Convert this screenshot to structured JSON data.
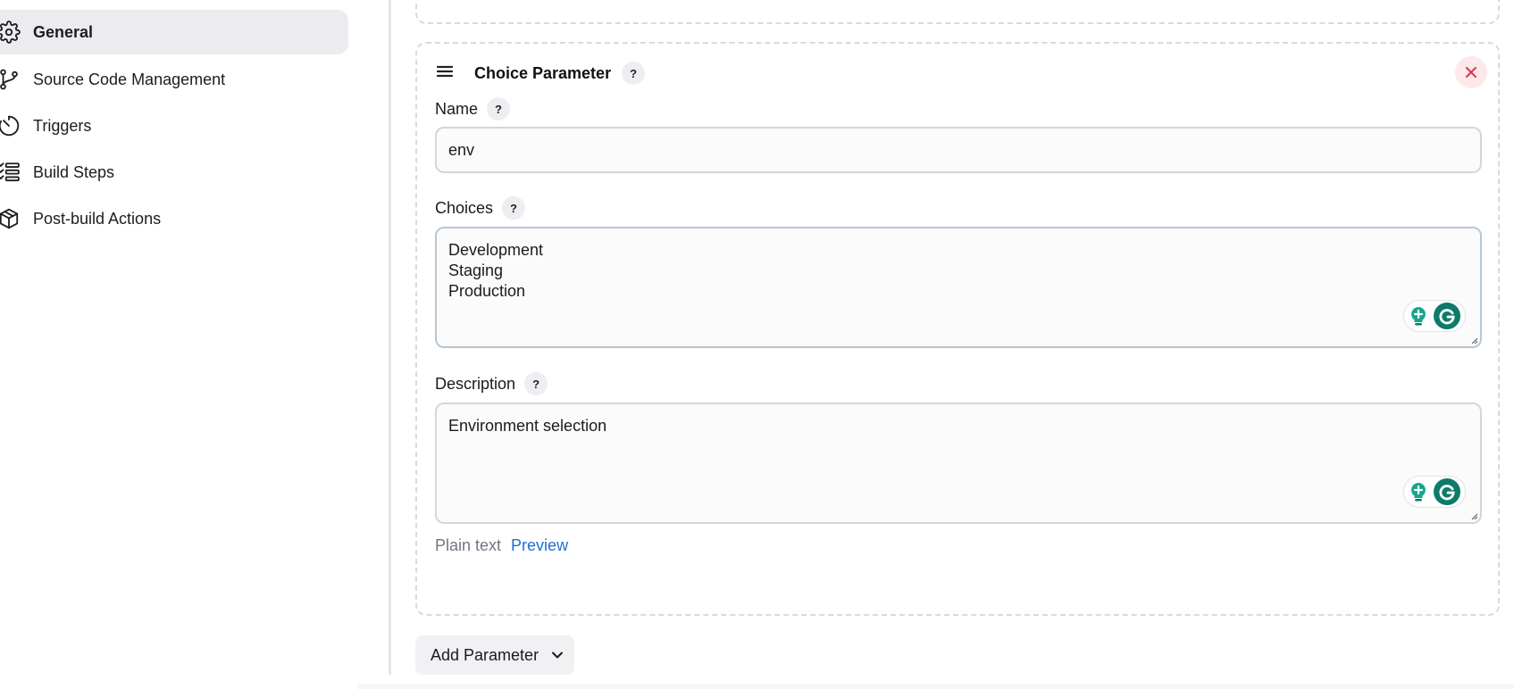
{
  "sidebar": {
    "items": [
      {
        "label": "General",
        "icon": "gear-icon",
        "active": true
      },
      {
        "label": "Source Code Management",
        "icon": "git-branch-icon",
        "active": false
      },
      {
        "label": "Triggers",
        "icon": "timer-icon",
        "active": false
      },
      {
        "label": "Build Steps",
        "icon": "list-steps-icon",
        "active": false
      },
      {
        "label": "Post-build Actions",
        "icon": "package-icon",
        "active": false
      }
    ]
  },
  "parameter": {
    "title": "Choice Parameter",
    "help": "?",
    "name": {
      "label": "Name",
      "value": "env"
    },
    "choices": {
      "label": "Choices",
      "lines": [
        "Development",
        "Staging",
        "Production"
      ]
    },
    "description": {
      "label": "Description",
      "value": "Environment selection"
    },
    "format": {
      "plain": "Plain text",
      "preview": "Preview"
    }
  },
  "add_parameter": {
    "label": "Add Parameter"
  },
  "colors": {
    "active_bg": "#ececf0",
    "close_red": "#d43a4b",
    "link_blue": "#1f6fd1",
    "grammarly_green": "#0e7a6a"
  }
}
